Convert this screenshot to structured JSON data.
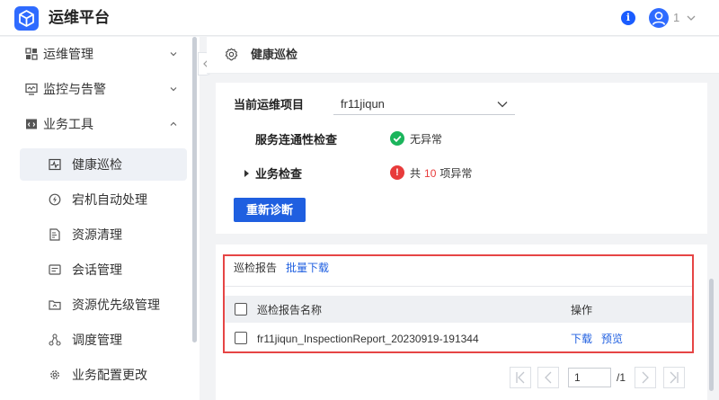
{
  "header": {
    "app_title": "运维平台",
    "info_icon": "i",
    "user_num": "1"
  },
  "sidebar": {
    "groups": [
      {
        "label": "运维管理",
        "icon": "grid-icon"
      },
      {
        "label": "监控与告警",
        "icon": "monitor-icon"
      },
      {
        "label": "业务工具",
        "icon": "code-window-icon"
      }
    ],
    "items": [
      {
        "label": "健康巡检",
        "icon": "heartbeat-icon",
        "active": true
      },
      {
        "label": "宕机自动处理",
        "icon": "bolt-icon"
      },
      {
        "label": "资源清理",
        "icon": "document-clean-icon"
      },
      {
        "label": "会话管理",
        "icon": "session-icon"
      },
      {
        "label": "资源优先级管理",
        "icon": "folder-priority-icon"
      },
      {
        "label": "调度管理",
        "icon": "schedule-icon"
      },
      {
        "label": "业务配置更改",
        "icon": "config-gear-icon"
      }
    ]
  },
  "breadcrumb": {
    "title": "健康巡检"
  },
  "inspection": {
    "project_label": "当前运维项目",
    "project_value": "fr11jiqun",
    "conn_label": "服务连通性检查",
    "conn_status": "无异常",
    "biz_label": "业务检查",
    "biz_prefix": "共",
    "biz_count": "10",
    "biz_suffix": "项异常",
    "warn_icon": "!",
    "rediag_button": "重新诊断"
  },
  "report": {
    "title": "巡检报告",
    "batch_download": "批量下载",
    "col_name": "巡检报告名称",
    "col_ops": "操作",
    "rows": [
      {
        "name": "fr11jiqun_InspectionReport_20230919-191344",
        "download": "下载",
        "preview": "预览"
      }
    ]
  },
  "pagination": {
    "current": "1",
    "total": "/1"
  },
  "colors": {
    "primary": "#1f5fe0",
    "success": "#1bb55c",
    "danger": "#e83b3b",
    "highlight_border": "#e64545"
  }
}
